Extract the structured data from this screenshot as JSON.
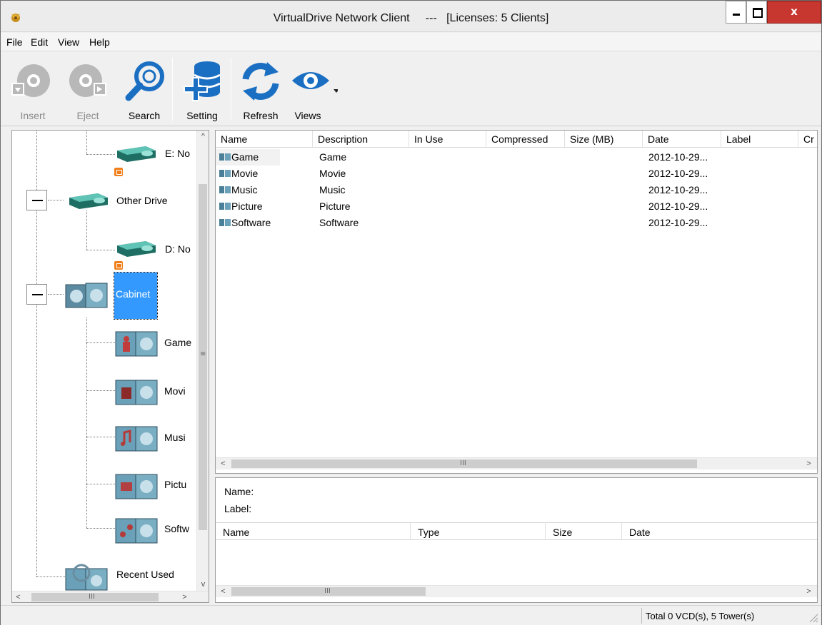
{
  "window": {
    "title": "VirtualDrive Network Client     ---   [Licenses: 5 Clients]",
    "close_glyph": "x"
  },
  "menu": [
    "File",
    "Edit",
    "View",
    "Help"
  ],
  "toolbar": {
    "insert": "Insert",
    "eject": "Eject",
    "search": "Search",
    "setting": "Setting",
    "refresh": "Refresh",
    "views": "Views"
  },
  "tree": {
    "drive_e": "E: No",
    "other_drive": "Other Drive",
    "drive_d": "D: No",
    "cabinet": "Cabinet",
    "children": [
      "Game",
      "Movi",
      "Musi",
      "Pictu",
      "Softw"
    ],
    "recent_used": "Recent Used"
  },
  "list": {
    "columns": [
      "Name",
      "Description",
      "In Use",
      "Compressed",
      "Size (MB)",
      "Date",
      "Label",
      "Cr"
    ],
    "rows": [
      {
        "name": "Game",
        "description": "Game",
        "date": "2012-10-29..."
      },
      {
        "name": "Movie",
        "description": "Movie",
        "date": "2012-10-29..."
      },
      {
        "name": "Music",
        "description": "Music",
        "date": "2012-10-29..."
      },
      {
        "name": "Picture",
        "description": "Picture",
        "date": "2012-10-29..."
      },
      {
        "name": "Software",
        "description": "Software",
        "date": "2012-10-29..."
      }
    ]
  },
  "detail": {
    "name_label": "Name:",
    "label_label": "Label:",
    "columns": [
      "Name",
      "Type",
      "Size",
      "Date"
    ]
  },
  "scroll": {
    "up": "^",
    "down": "v",
    "left": "<",
    "right": ">",
    "grip_h": "III",
    "grip_v": "≡"
  },
  "status": {
    "text": "Total 0 VCD(s), 5 Tower(s)"
  },
  "colors": {
    "selection": "#3399ff",
    "icon_blue": "#1b6fc2",
    "close_red": "#c7372f",
    "lock_orange": "#f07f1b"
  }
}
